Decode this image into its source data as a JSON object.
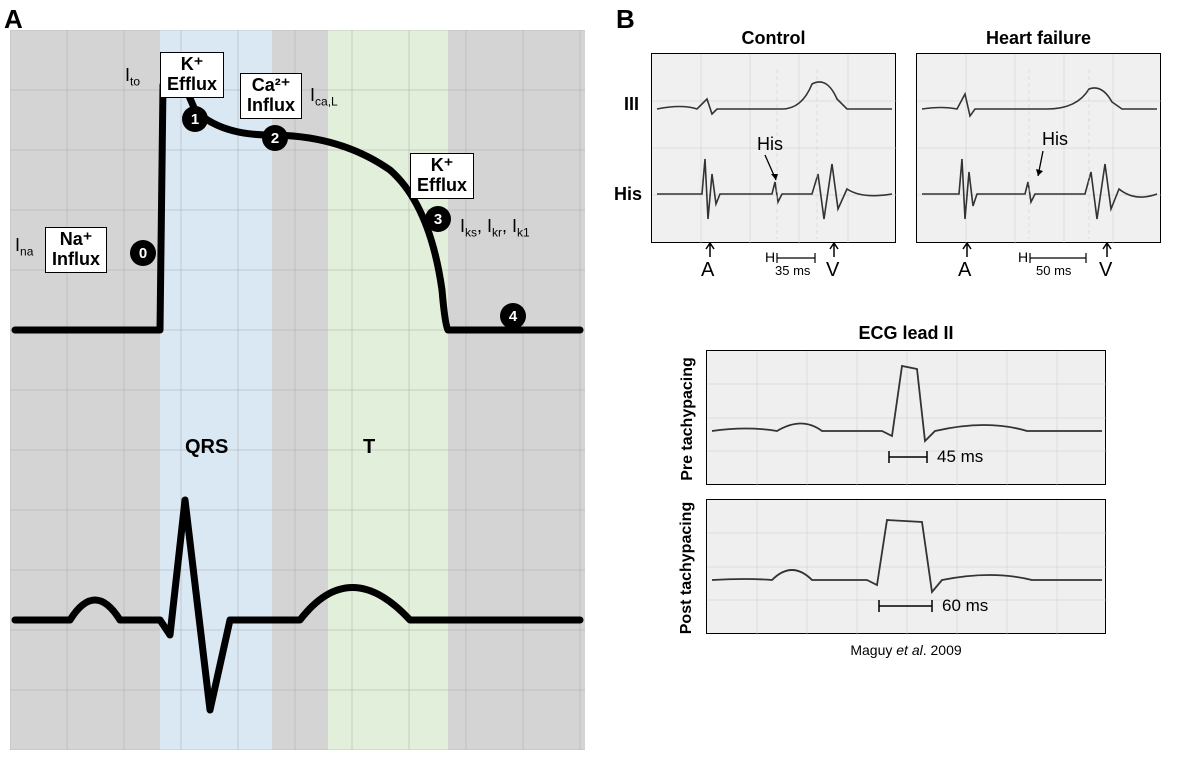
{
  "panelA": {
    "label": "A",
    "currents": {
      "ina": "I",
      "ina_sub": "na",
      "ito": "I",
      "ito_sub": "to",
      "ical": "I",
      "ical_sub": "ca,L",
      "ik": "I",
      "ik_sub1": "ks",
      "ik_sub2": "kr",
      "ik_sub3": "k1"
    },
    "boxes": {
      "na": "Na⁺\nInflux",
      "k1": "K⁺\nEfflux",
      "ca": "Ca²⁺\nInflux",
      "k2": "K⁺\nEfflux"
    },
    "phases": {
      "p0": "0",
      "p1": "1",
      "p2": "2",
      "p3": "3",
      "p4": "4"
    },
    "ecg_labels": {
      "qrs": "QRS",
      "t": "T"
    }
  },
  "panelB": {
    "label": "B",
    "titles": {
      "control": "Control",
      "hf": "Heart failure",
      "ecg": "ECG lead II"
    },
    "row_labels": {
      "iii": "III",
      "his": "His"
    },
    "markers": {
      "A": "A",
      "H": "H",
      "V": "V",
      "his_lbl": "His"
    },
    "intervals": {
      "control_hv": "35 ms",
      "hf_hv": "50 ms",
      "pre": "45 ms",
      "post": "60 ms"
    },
    "tachy_labels": {
      "pre": "Pre tachypacing",
      "post": "Post tachypacing"
    },
    "citation": "Maguy et al. 2009"
  },
  "chart_data": {
    "type": "diagram",
    "description": "Cardiac action potential phases with corresponding ECG waveform and His bundle recordings",
    "panelA": {
      "action_potential_phases": [
        {
          "phase": 0,
          "current": "I_Na",
          "ion": "Na+ Influx"
        },
        {
          "phase": 1,
          "current": "I_to",
          "ion": "K+ Efflux"
        },
        {
          "phase": 2,
          "current": "I_Ca,L",
          "ion": "Ca2+ Influx"
        },
        {
          "phase": 3,
          "current": "I_ks, I_kr, I_k1",
          "ion": "K+ Efflux"
        },
        {
          "phase": 4,
          "current": "resting",
          "ion": ""
        }
      ],
      "ecg_components": [
        "P",
        "QRS",
        "T"
      ],
      "band_qrs": "blue",
      "band_t": "green"
    },
    "panelB": {
      "top_recordings": [
        {
          "condition": "Control",
          "leads": [
            "III",
            "His"
          ],
          "HV_interval_ms": 35,
          "markers": [
            "A",
            "H",
            "V"
          ]
        },
        {
          "condition": "Heart failure",
          "leads": [
            "III",
            "His"
          ],
          "HV_interval_ms": 50,
          "markers": [
            "A",
            "H",
            "V"
          ]
        }
      ],
      "bottom_recordings": [
        {
          "condition": "Pre tachypacing",
          "lead": "ECG lead II",
          "QRS_duration_ms": 45
        },
        {
          "condition": "Post tachypacing",
          "lead": "ECG lead II",
          "QRS_duration_ms": 60
        }
      ],
      "citation": "Maguy et al. 2009"
    }
  }
}
